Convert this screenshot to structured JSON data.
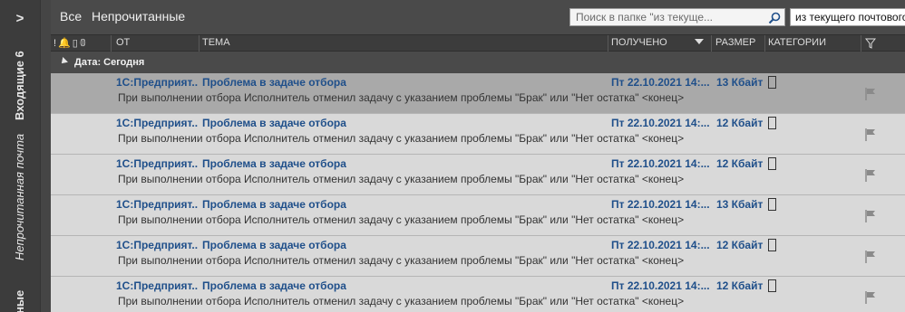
{
  "rail": {
    "inbox_label": "Входящие 6",
    "unread_label": "Непрочитанная почта",
    "saved_label": "енные"
  },
  "filters": {
    "all": "Все",
    "unread": "Непрочитанные"
  },
  "search": {
    "placeholder": "Поиск в папке \"из текуще...",
    "scope": "из текущего почтового ящика"
  },
  "columns": {
    "from": "ОТ",
    "subject": "ТЕМА",
    "received": "ПОЛУЧЕНО",
    "size": "РАЗМЕР",
    "categories": "КАТЕГОРИИ"
  },
  "group": {
    "label": "Дата: Сегодня"
  },
  "messages": [
    {
      "from": "1С:Предприят...",
      "subject": "Проблема в задаче отбора",
      "date": "Пт 22.10.2021 14:...",
      "size": "13 Кбайт",
      "preview": "При выполнении отбора Исполнитель отменил задачу с указанием проблемы \"Брак\" или \"Нет остатка\" <конец>"
    },
    {
      "from": "1С:Предприят...",
      "subject": "Проблема в задаче отбора",
      "date": "Пт 22.10.2021 14:...",
      "size": "12 Кбайт",
      "preview": "При выполнении отбора Исполнитель отменил задачу с указанием проблемы \"Брак\" или \"Нет остатка\" <конец>"
    },
    {
      "from": "1С:Предприят...",
      "subject": "Проблема в задаче отбора",
      "date": "Пт 22.10.2021 14:...",
      "size": "12 Кбайт",
      "preview": "При выполнении отбора Исполнитель отменил задачу с указанием проблемы \"Брак\" или \"Нет остатка\" <конец>"
    },
    {
      "from": "1С:Предприят...",
      "subject": "Проблема в задаче отбора",
      "date": "Пт 22.10.2021 14:...",
      "size": "13 Кбайт",
      "preview": "При выполнении отбора Исполнитель отменил задачу с указанием проблемы \"Брак\" или \"Нет остатка\" <конец>"
    },
    {
      "from": "1С:Предприят...",
      "subject": "Проблема в задаче отбора",
      "date": "Пт 22.10.2021 14:...",
      "size": "12 Кбайт",
      "preview": "При выполнении отбора Исполнитель отменил задачу с указанием проблемы \"Брак\" или \"Нет остатка\" <конец>"
    },
    {
      "from": "1С:Предприят...",
      "subject": "Проблема в задаче отбора",
      "date": "Пт 22.10.2021 14:...",
      "size": "12 Кбайт",
      "preview": "При выполнении отбора Исполнитель отменил задачу с указанием проблемы \"Брак\" или \"Нет остатка\" <конец>"
    }
  ],
  "colors": {
    "link_blue": "#1f4f8a",
    "selected_row": "#a9a9a9",
    "row_bg": "#d9d9d9"
  }
}
